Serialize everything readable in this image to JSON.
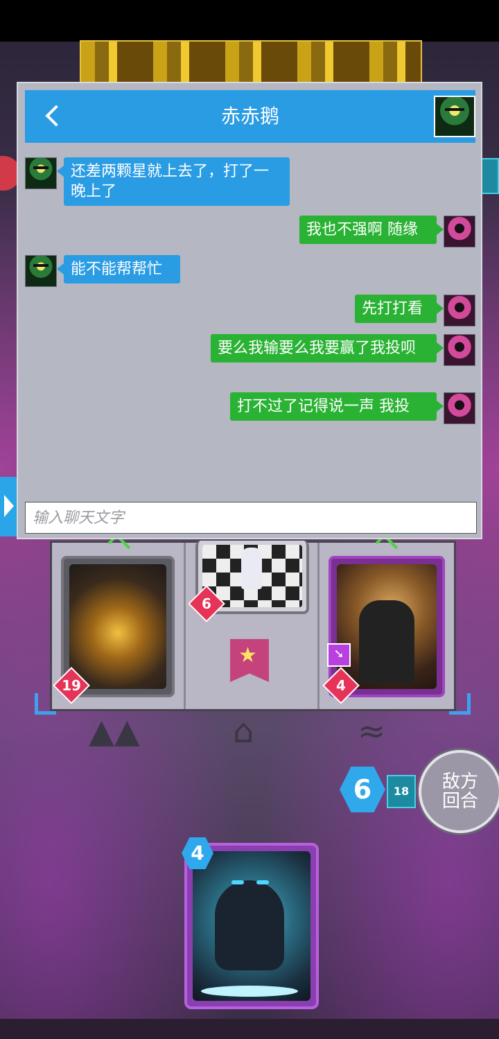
{
  "chat": {
    "title": "赤赤鹅",
    "input_placeholder": "输入聊天文字",
    "messages": [
      {
        "side": "in",
        "text": "还差两颗星就上去了，打了一晚上了"
      },
      {
        "side": "out",
        "text": "我也不强啊 随缘"
      },
      {
        "side": "in",
        "text": "能不能帮帮忙"
      },
      {
        "side": "out",
        "text": "先打打看"
      },
      {
        "side": "out",
        "text": "要么我输要么我要赢了我投呗"
      },
      {
        "side": "out",
        "text": "打不过了记得说一声 我投"
      }
    ]
  },
  "board": {
    "lane_cards": [
      {
        "power": "19"
      },
      {
        "power": "6"
      },
      {
        "power": "4"
      }
    ],
    "energy": "6",
    "deck_count": "18",
    "end_turn_label": "敌方回合",
    "hand_card_cost": "4"
  },
  "colors": {
    "accent_blue": "#2a9ce4",
    "bubble_green": "#2ab234",
    "power_red": "#e63358"
  }
}
